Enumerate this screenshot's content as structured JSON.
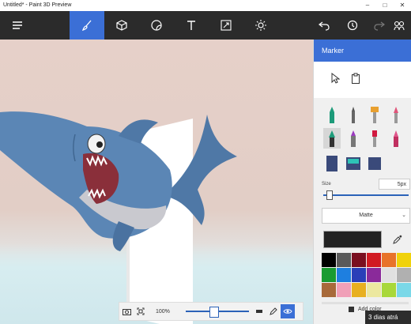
{
  "window": {
    "title": "Untitled* - Paint 3D Preview",
    "controls": [
      "–",
      "□",
      "✕"
    ]
  },
  "toolbar": {
    "tools": [
      {
        "name": "menu-icon"
      },
      {
        "name": "brush-icon",
        "active": true
      },
      {
        "name": "cube-icon"
      },
      {
        "name": "sticker-icon"
      },
      {
        "name": "text-icon"
      },
      {
        "name": "canvas-resize-icon"
      },
      {
        "name": "effects-icon"
      }
    ],
    "right_tools": [
      "undo-icon",
      "history-icon",
      "redo-icon",
      "remix-icon"
    ]
  },
  "side_panel": {
    "title": "Marker",
    "size_label": "Size",
    "size_value": "5px",
    "finish": "Matte",
    "add_color_label": "Add color",
    "palette": [
      "#000000",
      "#5a5a5a",
      "#7a0f20",
      "#d11a22",
      "#e8732a",
      "#f0d20a",
      "#1a9b32",
      "#1e7fe0",
      "#2a3fb8",
      "#8a2a9a",
      "#e0e0e0",
      "#b0b0b0",
      "#a86a3a",
      "#f0a0b8",
      "#e8b020",
      "#ece8a0",
      "#a8d83a",
      "#7ad8e8"
    ],
    "current_color": "#222222"
  },
  "bottom_bar": {
    "zoom": "100%"
  },
  "notification": "3 dias atrá"
}
